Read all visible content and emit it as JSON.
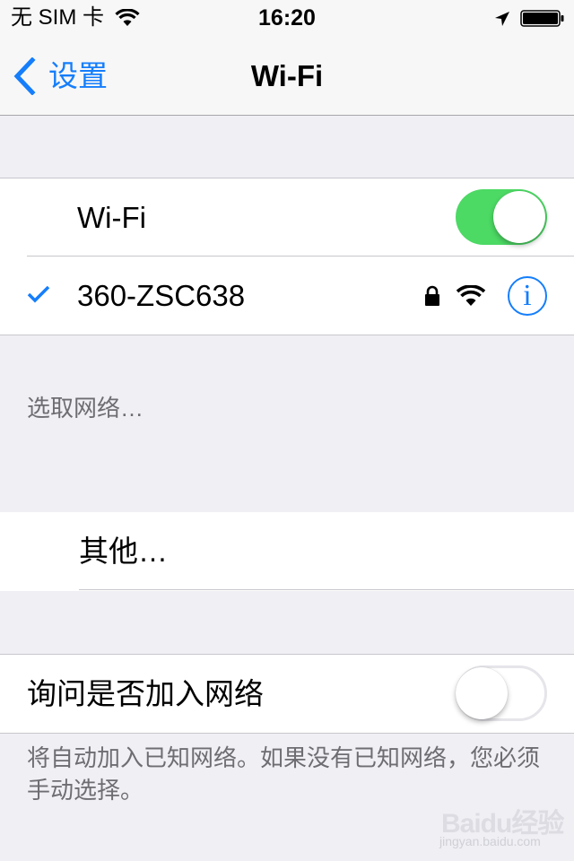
{
  "status_bar": {
    "carrier": "无 SIM 卡",
    "time": "16:20",
    "icons": [
      "wifi-signal-icon",
      "location-arrow-icon",
      "battery-icon"
    ]
  },
  "nav": {
    "back_label": "设置",
    "title": "Wi-Fi"
  },
  "wifi_group": {
    "wifi_label": "Wi-Fi",
    "wifi_enabled": true,
    "connected_network": {
      "name": "360-ZSC638",
      "selected": true,
      "secured": true,
      "info_glyph": "i"
    }
  },
  "choose_network": {
    "header": "选取网络…",
    "other_label": "其他…"
  },
  "ask_join": {
    "label": "询问是否加入网络",
    "enabled": false,
    "footer": "将自动加入已知网络。如果没有已知网络，您必须手动选择。"
  },
  "watermark": {
    "logo": "Baidu经验",
    "url": "jingyan.baidu.com"
  },
  "colors": {
    "accent": "#157efb",
    "toggle_on": "#4cd964",
    "background": "#efeff4",
    "secondary_text": "#6d6d72"
  }
}
